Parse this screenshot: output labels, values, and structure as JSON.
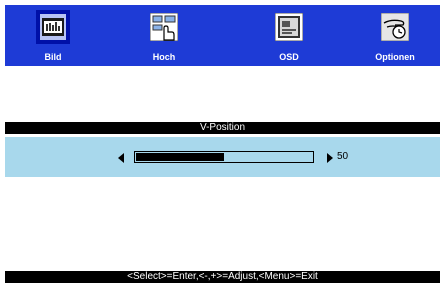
{
  "menu": {
    "items": [
      {
        "label": "Bild",
        "icon": "picture-icon",
        "selected": true
      },
      {
        "label": "Hoch",
        "icon": "touch-icon",
        "selected": false
      },
      {
        "label": "OSD",
        "icon": "osd-icon",
        "selected": false
      },
      {
        "label": "Optionen",
        "icon": "options-hand-icon",
        "selected": false
      }
    ]
  },
  "adjust": {
    "title": "V-Position",
    "value": 50,
    "value_text": "50",
    "fill_fraction": 0.5
  },
  "status": {
    "text": "<Select>=Enter,<-,+>=Adjust,<Menu>=Exit"
  },
  "colors": {
    "menubar": "#1e3bd6",
    "adjust_row": "#a8d8ec",
    "bar": "#000000"
  }
}
